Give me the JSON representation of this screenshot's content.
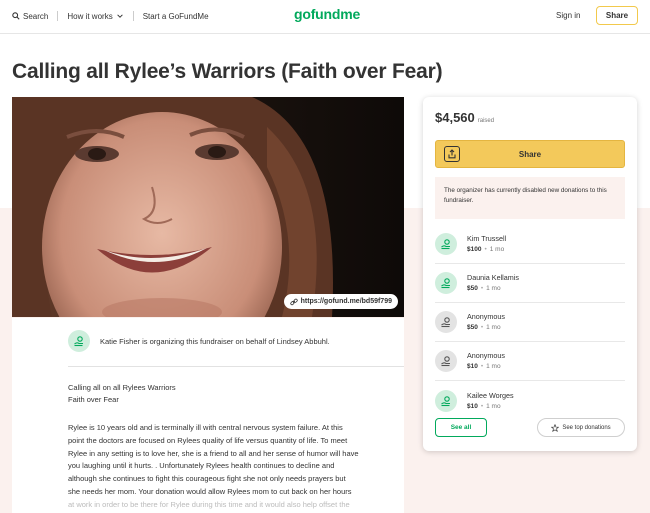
{
  "header": {
    "search_label": "Search",
    "how_it_works_label": "How it works",
    "start_label": "Start a GoFundMe",
    "logo": "gofundme",
    "signin_label": "Sign in",
    "share_label": "Share"
  },
  "campaign": {
    "title": "Calling all Rylee’s Warriors (Faith over Fear)",
    "short_url": "https://gofund.me/bd59f799",
    "organizer_text": "Katie Fisher is organizing this fundraiser on behalf of Lindsey Abbuhl.",
    "intro_line1": "Calling all on all Rylees Warriors",
    "intro_line2": "Faith over Fear",
    "story_lines": [
      "Rylee is 10 years old and is terminally ill with central nervous system failure. At this",
      "point the doctors are focused on Rylees quality of life versus quantity of life. To meet",
      "Rylee in any setting is to love her, she is a friend to all and her sense of humor will have",
      "you laughing until it hurts. . Unfortunately Rylees health continues to decline and",
      "although she continues to fight this courageous fight she not only needs prayers but",
      "she needs her mom. Your donation would allow Rylees mom to cut back on her hours"
    ],
    "story_faded": "at work in order to be there for Rylee during this time and it would also help offset the"
  },
  "sidebar": {
    "amount": "$4,560",
    "raised_label": "raised",
    "share_label": "Share",
    "notice": "The organizer has currently disabled new donations to this fundraiser.",
    "donations": [
      {
        "name": "Kim Trussell",
        "amount": "$100",
        "ago": "1 mo",
        "anonymous": false
      },
      {
        "name": "Daunia Kellamis",
        "amount": "$50",
        "ago": "1 mo",
        "anonymous": false
      },
      {
        "name": "Anonymous",
        "amount": "$50",
        "ago": "1 mo",
        "anonymous": true
      },
      {
        "name": "Anonymous",
        "amount": "$10",
        "ago": "1 mo",
        "anonymous": true
      },
      {
        "name": "Kailee Worges",
        "amount": "$10",
        "ago": "1 mo",
        "anonymous": false
      }
    ],
    "see_all_label": "See all",
    "top_donations_label": "See top donations"
  },
  "icons": {
    "search": "search-icon",
    "chevron": "chevron-down-icon",
    "share": "share-icon",
    "link": "link-icon",
    "hand_heart": "hand-heart-icon",
    "star": "star-icon"
  },
  "colors": {
    "brand_green": "#02a95c",
    "share_yellow": "#f3c95b",
    "notice_bg": "#fbf1ee"
  }
}
